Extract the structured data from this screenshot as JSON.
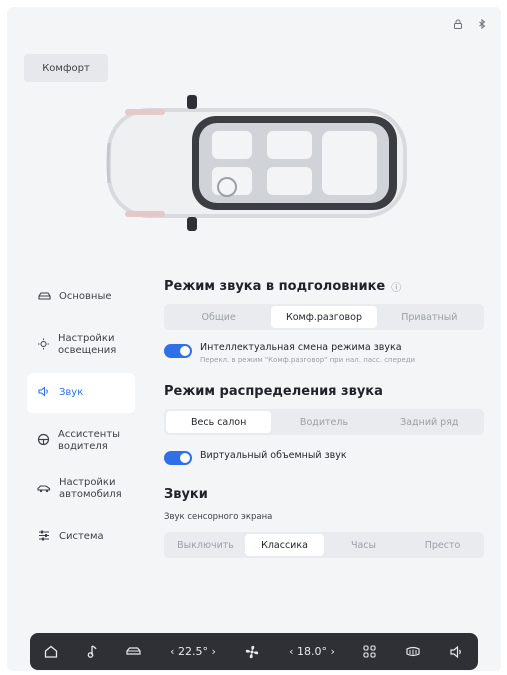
{
  "top_icons": {
    "lock": "lock-icon",
    "bluetooth": "bluetooth-icon"
  },
  "profile": {
    "label": "Комфорт"
  },
  "sidebar": {
    "items": [
      {
        "label": "Основные",
        "icon": "car-outline-icon"
      },
      {
        "label": "Настройки освещения",
        "icon": "lamp-icon"
      },
      {
        "label": "Звук",
        "icon": "speaker-icon"
      },
      {
        "label": "Ассистенты водителя",
        "icon": "steering-wheel-icon"
      },
      {
        "label": "Настройки автомобиля",
        "icon": "car-side-icon"
      },
      {
        "label": "Система",
        "icon": "sliders-icon"
      }
    ],
    "active_index": 2
  },
  "headrest": {
    "title": "Режим звука в подголовнике",
    "options": [
      "Общие",
      "Комф.разговор",
      "Приватный"
    ],
    "selected": "Комф.разговор",
    "toggle_title": "Интеллектуальная смена режима звука",
    "toggle_desc": "Перекл. в режим \"Комф.разговор\" при нал. пасс. спереди"
  },
  "distribution": {
    "title": "Режим распределения звука",
    "options": [
      "Весь салон",
      "Водитель",
      "Задний ряд"
    ],
    "selected": "Весь салон",
    "virtual_label": "Виртуальный объемный звук"
  },
  "sounds": {
    "title": "Звуки",
    "touch_label": "Звук сенсорного экрана",
    "options": [
      "Выключить",
      "Классика",
      "Часы",
      "Престо"
    ],
    "selected": "Классика"
  },
  "bottom_bar": {
    "left_temp": "22.5°",
    "right_temp": "18.0°",
    "left_arrow": "‹",
    "right_arrow": "›"
  },
  "colors": {
    "accent": "#2f6fe8",
    "bar_bg": "#2e3035",
    "panel_bg": "#f4f5f7"
  }
}
